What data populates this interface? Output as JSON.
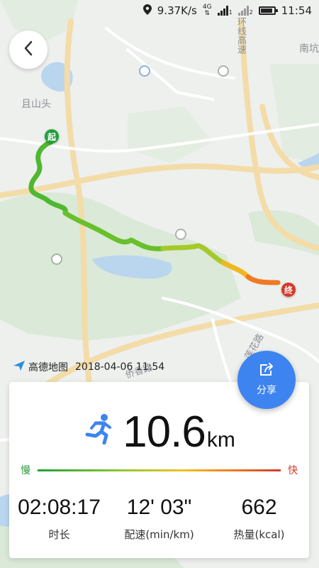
{
  "status_bar": {
    "speed": "9.37K/s",
    "network": "4G",
    "sim_marks": [
      "1",
      "2"
    ],
    "time": "11:54",
    "battery_level": 0.9
  },
  "map": {
    "labels": {
      "qieshantou": "且山头",
      "expressway": "环线高速",
      "nankeng": "南坑",
      "lianhualu": "莲花路",
      "lixianglu": "侨香路"
    },
    "markers": {
      "start": "起",
      "end": "终"
    },
    "provider": "高德地图",
    "timestamp": "2018-04-06  11:54"
  },
  "share_button": {
    "label": "分享"
  },
  "summary": {
    "distance_value": "10.6",
    "distance_unit": "km",
    "pace_slow_label": "慢",
    "pace_fast_label": "快",
    "stats": [
      {
        "value": "02:08:17",
        "label": "时长"
      },
      {
        "value": "12' 03\"",
        "label": "配速(min/km)"
      },
      {
        "value": "662",
        "label": "热量(kcal)"
      }
    ]
  },
  "colors": {
    "slow": "#22a038",
    "fast": "#d33a2a",
    "accent": "#3d84f0",
    "runner": "#3d84f0"
  }
}
